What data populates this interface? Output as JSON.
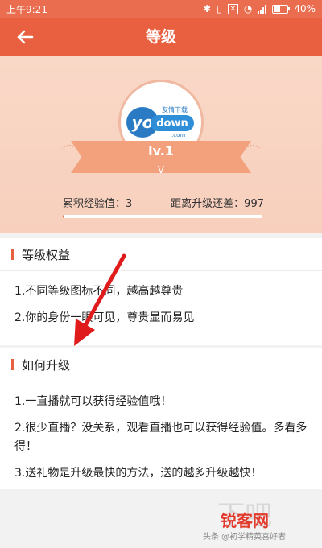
{
  "status_bar": {
    "time": "上午9:21",
    "battery": "40%"
  },
  "header": {
    "title": "等级",
    "back_icon": "back-arrow-icon"
  },
  "profile": {
    "logo_main": "yo",
    "logo_word": "down",
    "logo_tag": "友情下载",
    "logo_com": ".com",
    "level": "lv.1",
    "level_sub": "V",
    "exp_label": "累积经验值：3",
    "next_level_label": "距离升级还差：997",
    "progress": 0.003
  },
  "sections": {
    "benefits": {
      "title": "等级权益",
      "items": [
        "1.不同等级图标不同，越高越尊贵",
        "2.你的身份一眼可见，尊贵显而易见"
      ]
    },
    "upgrade": {
      "title": "如何升级",
      "items": [
        "1.一直播就可以获得经验值哦！",
        "2.很少直播？没关系，观看直播也可以获得经验值。多看多得！",
        "3.送礼物是升级最快的方法，送的越多升级越快！"
      ]
    }
  },
  "watermark": {
    "site": "锐客网",
    "line": "头条 @初学精英喜好者"
  },
  "colors": {
    "accent": "#e8603f",
    "hero_bg": "#f9d8c7",
    "ribbon": "#f3a07d"
  }
}
